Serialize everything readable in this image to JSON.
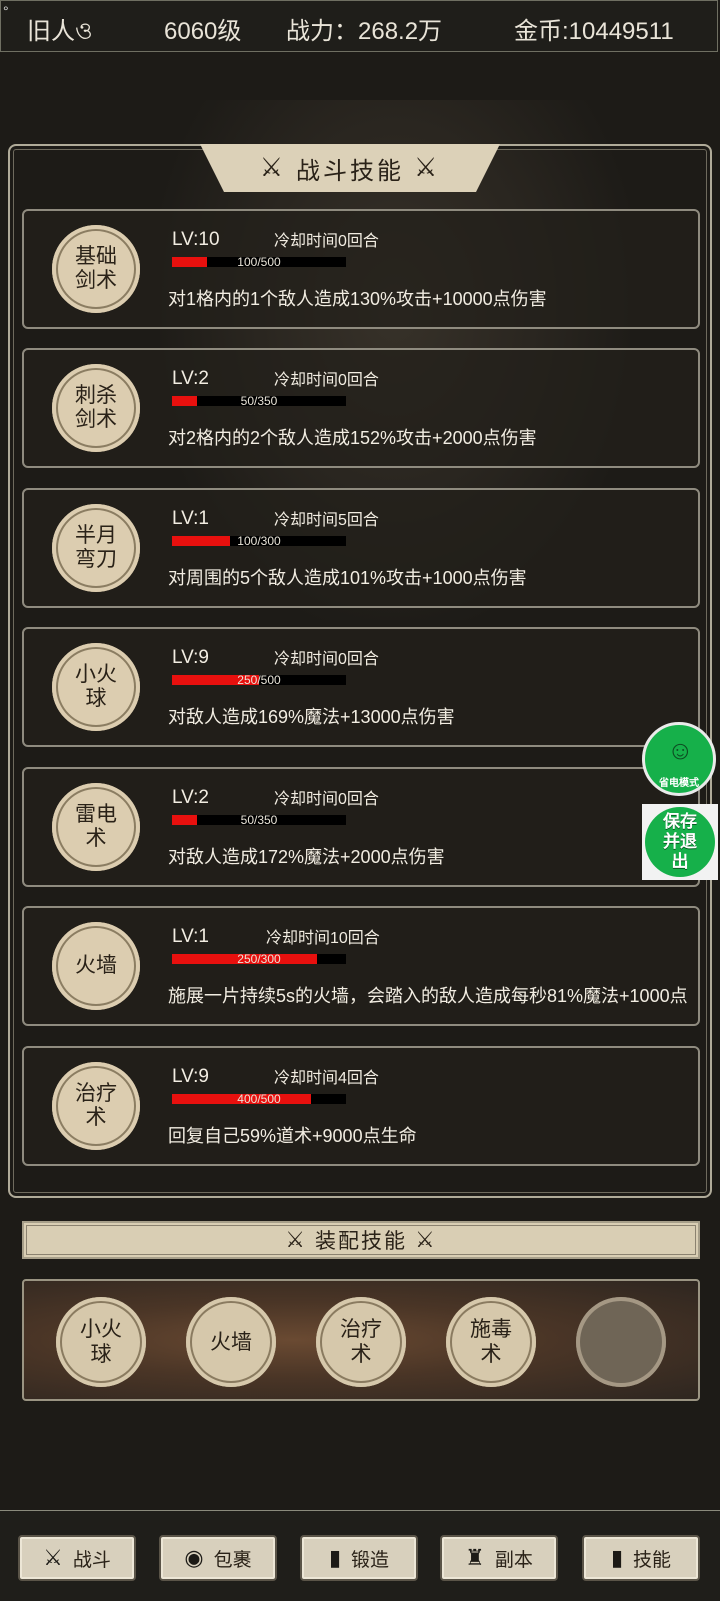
{
  "player": {
    "name": "旧人ও",
    "level": "6060级",
    "power": "战力：268.2万",
    "gold": "金币:10449511",
    "corner_mark": "°"
  },
  "panel_title": "战斗技能",
  "skills": [
    {
      "name": "基础剑术",
      "lv": "LV:10",
      "cooldown": "冷却时间0回合",
      "exp": "100/500",
      "exp_fraction": 0.2,
      "desc": "对1格内的1个敌人造成130%攻击+10000点伤害"
    },
    {
      "name": "刺杀剑术",
      "lv": "LV:2",
      "cooldown": "冷却时间0回合",
      "exp": "50/350",
      "exp_fraction": 0.143,
      "desc": "对2格内的2个敌人造成152%攻击+2000点伤害"
    },
    {
      "name": "半月弯刀",
      "lv": "LV:1",
      "cooldown": "冷却时间5回合",
      "exp": "100/300",
      "exp_fraction": 0.333,
      "desc": "对周围的5个敌人造成101%攻击+1000点伤害"
    },
    {
      "name": "小火球",
      "lv": "LV:9",
      "cooldown": "冷却时间0回合",
      "exp": "250/500",
      "exp_fraction": 0.5,
      "desc": "对敌人造成169%魔法+13000点伤害"
    },
    {
      "name": "雷电术",
      "lv": "LV:2",
      "cooldown": "冷却时间0回合",
      "exp": "50/350",
      "exp_fraction": 0.143,
      "desc": "对敌人造成172%魔法+2000点伤害"
    },
    {
      "name": "火墙",
      "lv": "LV:1",
      "cooldown": "冷却时间10回合",
      "exp": "250/300",
      "exp_fraction": 0.833,
      "desc": "施展一片持续5s的火墙，会踏入的敌人造成每秒81%魔法+1000点"
    },
    {
      "name": "治疗术",
      "lv": "LV:9",
      "cooldown": "冷却时间4回合",
      "exp": "400/500",
      "exp_fraction": 0.8,
      "desc": "回复自己59%道术+9000点生命"
    }
  ],
  "equip_title": "装配技能",
  "equipped": [
    "小火球",
    "火墙",
    "治疗术",
    "施毒术",
    ""
  ],
  "power_save": "省电模式",
  "save_exit": "保存并退出",
  "nav": [
    {
      "label": "战斗",
      "icon": "crossed-swords-icon"
    },
    {
      "label": "包裹",
      "icon": "bag-icon"
    },
    {
      "label": "锻造",
      "icon": "book-icon"
    },
    {
      "label": "副本",
      "icon": "tower-icon"
    },
    {
      "label": "技能",
      "icon": "book-icon"
    }
  ],
  "colors": {
    "exp_fill": "#e8100e",
    "button_green": "#16b04a",
    "badge": "#dccdb0"
  }
}
